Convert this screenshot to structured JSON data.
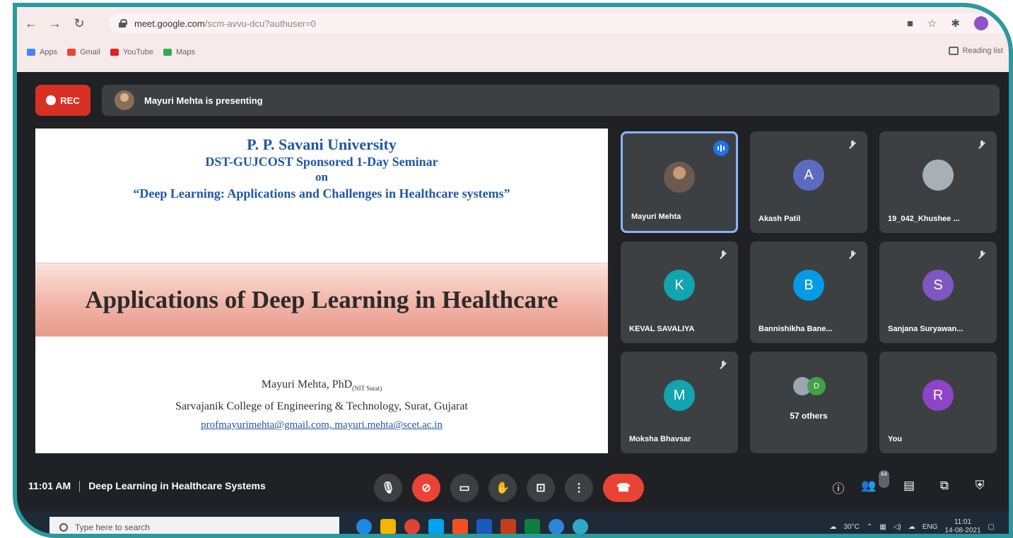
{
  "browser": {
    "url_host": "meet.google.com",
    "url_path": "/scm-avvu-dcu?authuser=0",
    "bookmarks": [
      {
        "label": "Apps",
        "color": "#4285f4"
      },
      {
        "label": "Gmail",
        "color": "#ea4335"
      },
      {
        "label": "YouTube",
        "color": "#e62117"
      },
      {
        "label": "Maps",
        "color": "#34a853"
      }
    ],
    "reading_list": "Reading list"
  },
  "meet": {
    "rec_label": "REC",
    "presenting_text": "Mayuri Mehta is presenting",
    "time": "11:01 AM",
    "meeting_title": "Deep Learning in Healthcare Systems",
    "people_count": "64"
  },
  "slide": {
    "line1": "P. P. Savani University",
    "line2": "DST-GUJCOST Sponsored 1-Day Seminar",
    "line3": "on",
    "line4": "“Deep Learning: Applications and Challenges in Healthcare systems”",
    "main_title": "Applications of Deep Learning in Healthcare",
    "author": "Mayuri Mehta, PhD",
    "author_sub": "(NIT Surat)",
    "institute": "Sarvajanik College of Engineering & Technology, Surat, Gujarat",
    "emails": "profmayurimehta@gmail.com, mayuri.mehta@scet.ac.in"
  },
  "participants": [
    {
      "name": "Mayuri Mehta",
      "initial": "",
      "color": "",
      "photo": true,
      "active": true
    },
    {
      "name": "Akash Patil",
      "initial": "A",
      "color": "#5c6bc0",
      "photo": false,
      "active": false
    },
    {
      "name": "19_042_Khushee ...",
      "initial": "",
      "color": "",
      "photo": true,
      "active": false
    },
    {
      "name": "KEVAL SAVALIYA",
      "initial": "K",
      "color": "#12a4af",
      "photo": false,
      "active": false
    },
    {
      "name": "Bannishikha Bane...",
      "initial": "B",
      "color": "#039be5",
      "photo": false,
      "active": false
    },
    {
      "name": "Sanjana Suryawan...",
      "initial": "S",
      "color": "#7e57c2",
      "photo": false,
      "active": false
    },
    {
      "name": "Moksha Bhavsar",
      "initial": "M",
      "color": "#12a4af",
      "photo": false,
      "active": false
    },
    {
      "name": "57 others",
      "initial": "D",
      "color": "#43a047",
      "photo": false,
      "active": false
    },
    {
      "name": "You",
      "initial": "R",
      "color": "#8e44c8",
      "photo": false,
      "active": false
    }
  ],
  "taskbar": {
    "search_placeholder": "Type here to search",
    "weather": "30°C",
    "lang": "ENG",
    "time": "11:01",
    "date": "14-08-2021"
  }
}
